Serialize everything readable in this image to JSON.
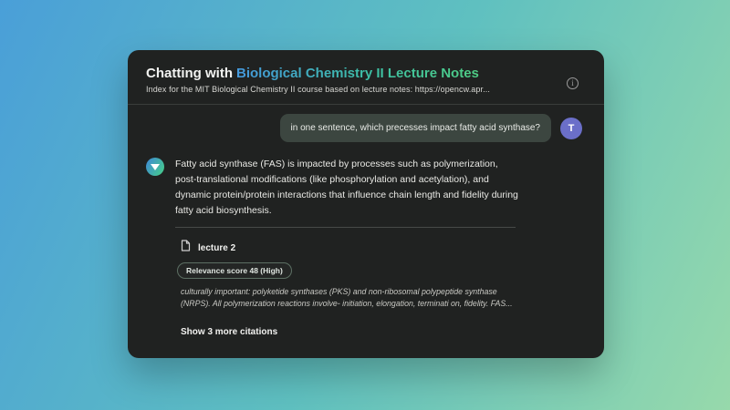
{
  "app": {
    "background_gradient_from": "#4a9fd8",
    "background_gradient_to": "#97d9ab",
    "card_background": "#202221"
  },
  "header": {
    "title_prefix": "Chatting with",
    "title_highlight": "Biological Chemistry II Lecture Notes",
    "title_gradient_from": "#4599dd",
    "title_gradient_to": "#4fce85",
    "subtitle": "Index for the MIT Biological Chemistry II course based on lecture notes: https://opencw.apr...",
    "info_icon": "info-circle",
    "info_glyph": "i"
  },
  "chat": {
    "user_message": {
      "text": "in one sentence, which precesses impact fatty acid synthase?",
      "avatar_letter": "T",
      "avatar_color": "#6b6fc9",
      "bubble_color": "#3c4640"
    },
    "assistant_message": {
      "avatar_icon": "funnel-triangle",
      "avatar_gradient_from": "#3f8fd0",
      "avatar_gradient_to": "#45c98e",
      "text": "Fatty acid synthase (FAS) is impacted by processes such as polymerization, post-translational modifications (like phosphorylation and acetylation), and dynamic protein/protein interactions that influence chain length and fidelity during fatty acid biosynthesis."
    },
    "citation": {
      "doc_icon": "document",
      "source": "lecture 2",
      "relevance_badge": "Relevance score 48 (High)",
      "excerpt": "culturally important: polyketide synthases (PKS) and non-ribosomal polypeptide synthase (NRPS). All polymerization reactions involve- initiation, elongation, terminati on, fidelity. FAS...",
      "show_more_label": "Show 3 more citations"
    }
  }
}
